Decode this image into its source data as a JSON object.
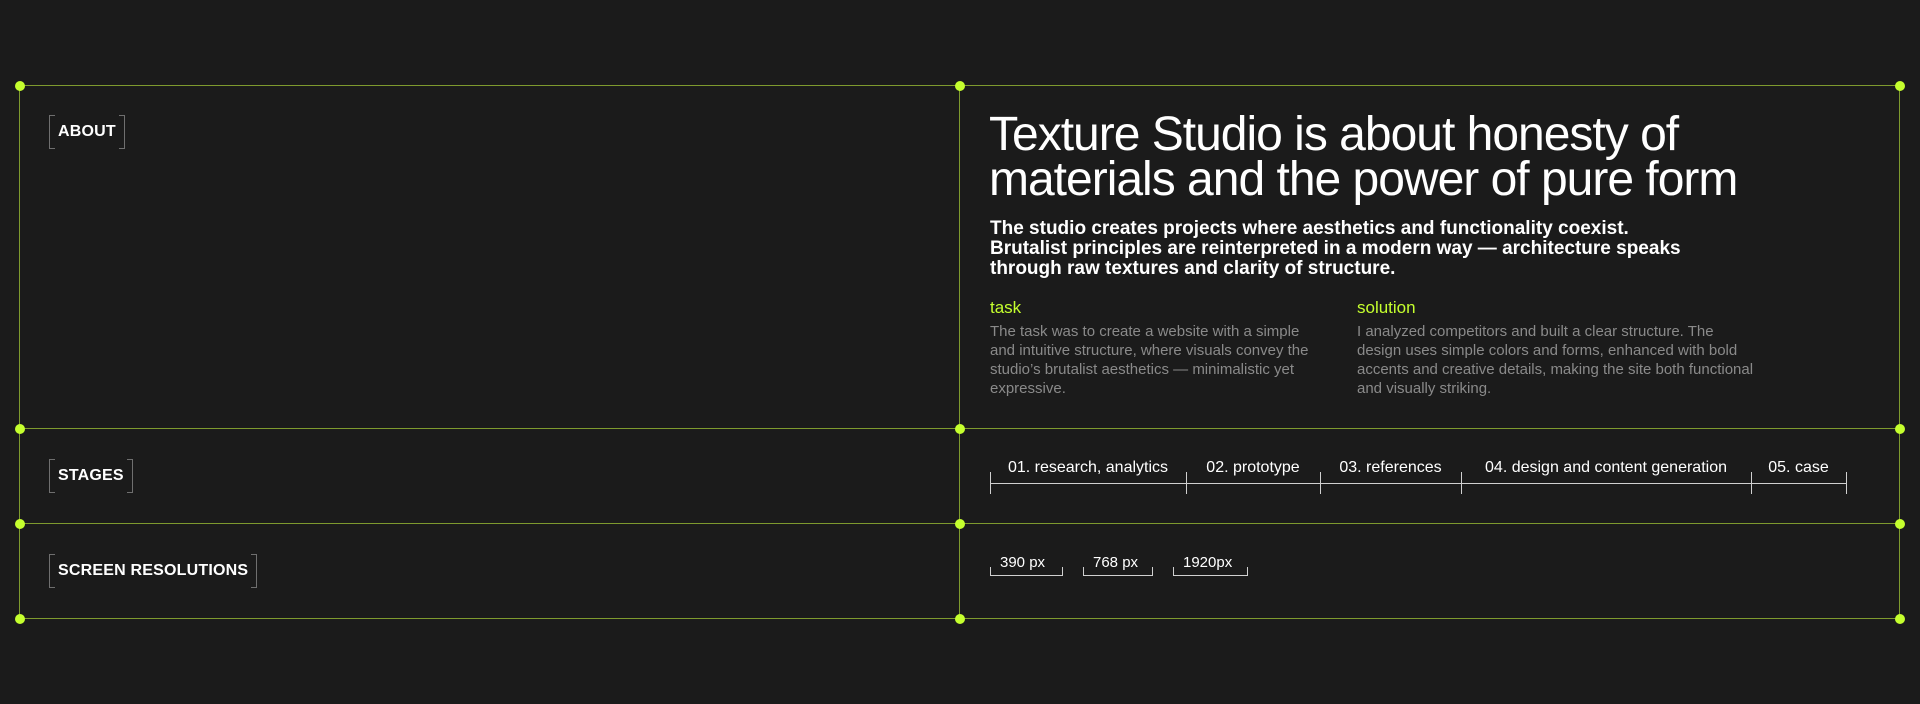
{
  "sections": {
    "about_label": "ABOUT",
    "stages_label": "STAGES",
    "resolutions_label": "SCREEN RESOLUTIONS"
  },
  "about": {
    "headline": "Texture Studio is about honesty of materials and the power of pure form",
    "lead": "The studio creates projects where aesthetics and functionality coexist. Brutalist principles are reinterpreted in a modern way — architecture speaks through raw textures and clarity of structure.",
    "task_title": "task",
    "task_text": "The task was to create a website with a simple and intuitive structure, where visuals convey the studio’s brutalist aesthetics — minimalistic yet expressive.",
    "solution_title": "solution",
    "solution_text": "I analyzed competitors and built a clear structure. The design uses simple colors and forms, enhanced with bold accents and creative details, making the site both functional and visually striking."
  },
  "stages": [
    "01. research, analytics",
    "02. prototype",
    "03. references",
    "04. design and content generation",
    "05. case"
  ],
  "resolutions": [
    "390 px",
    "768 px",
    "1920px"
  ],
  "colors": {
    "background": "#1b1b1b",
    "accent": "#c5ff2e",
    "grid_line": "#7e9a2e",
    "muted_text": "#8a8a8a"
  }
}
